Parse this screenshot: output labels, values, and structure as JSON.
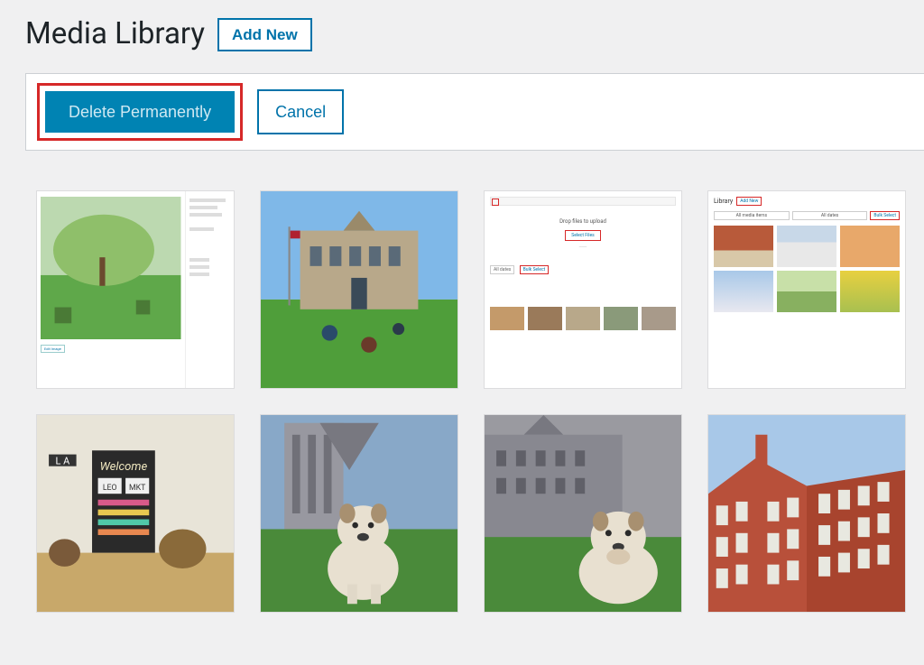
{
  "header": {
    "title": "Media Library",
    "add_new_label": "Add New"
  },
  "action_bar": {
    "delete_label": "Delete Permanently",
    "cancel_label": "Cancel"
  },
  "thumb_b": {
    "drop_text": "Drop files to upload",
    "select_text": "Select Files",
    "all_dates": "All dates",
    "bulk": "Bulk Select"
  },
  "thumb_c": {
    "title": "Library",
    "add_new": "Add New",
    "all_media": "All media items",
    "all_dates": "All dates",
    "bulk": "Bulk Select"
  },
  "thumb_a": {
    "edit": "Edit Image"
  }
}
